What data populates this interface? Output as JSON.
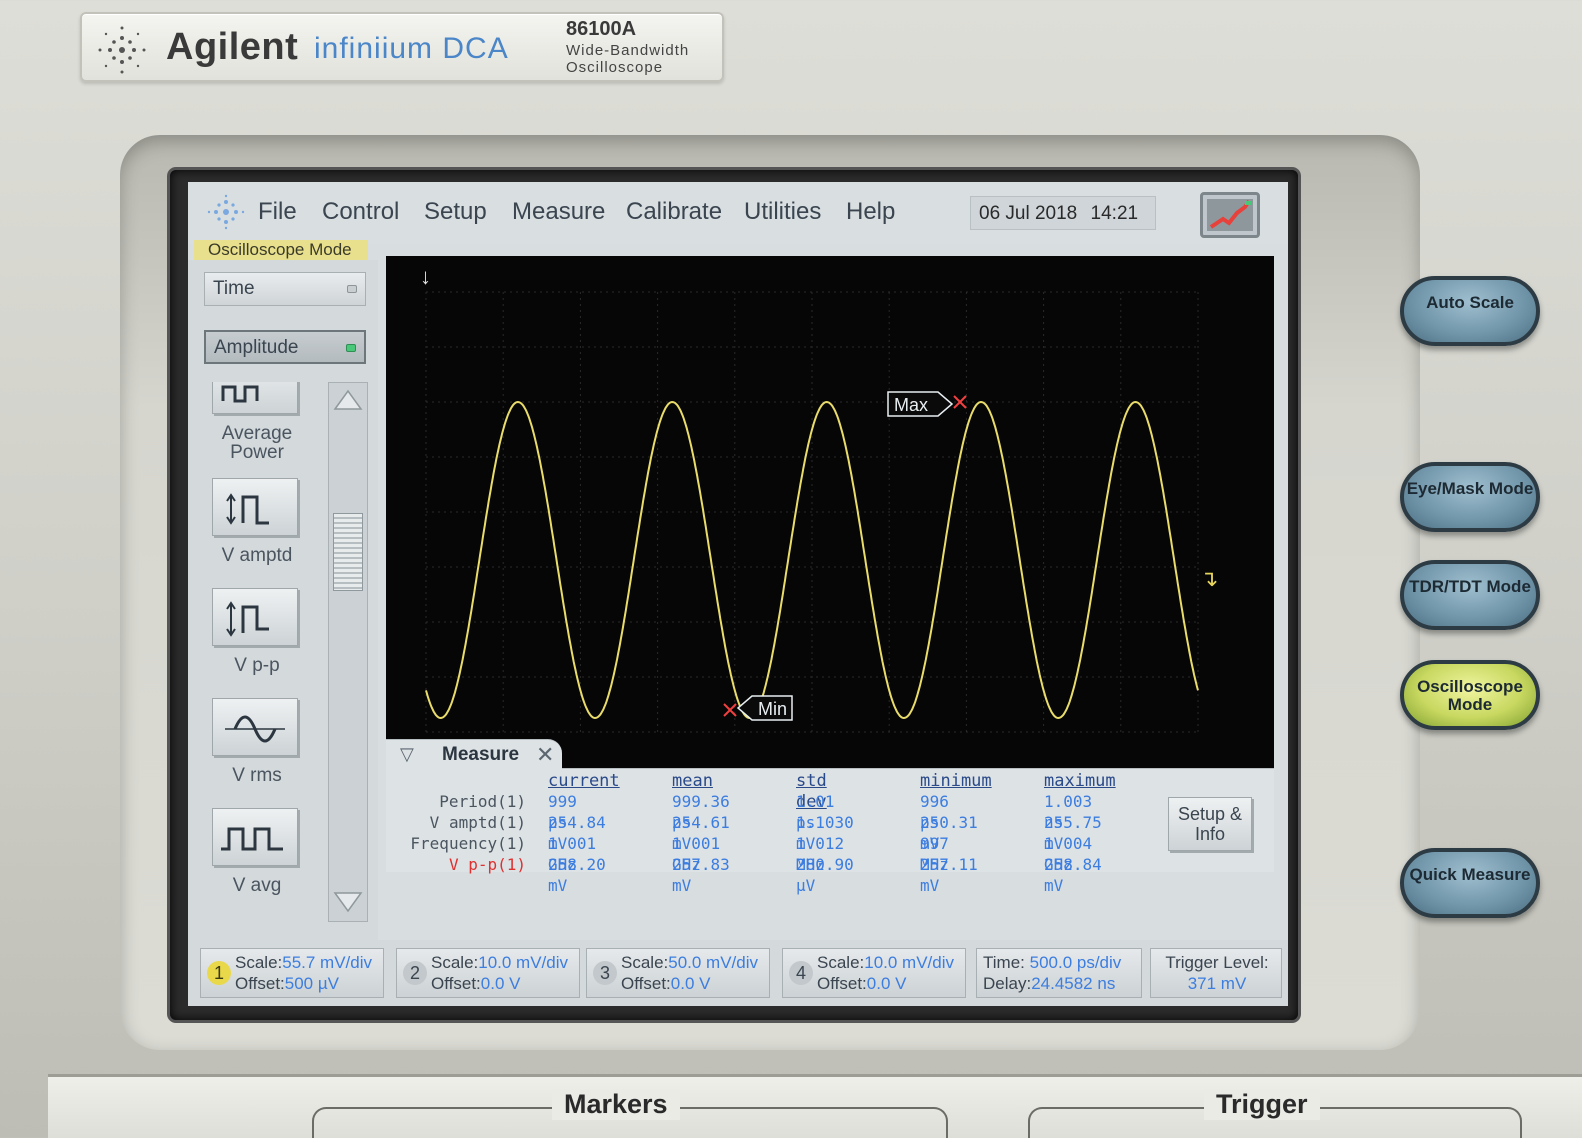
{
  "brand": {
    "name": "Agilent",
    "product": "infiniium DCA",
    "model": "86100A",
    "description_line1": "Wide-Bandwidth",
    "description_line2": "Oscilloscope"
  },
  "menu": {
    "items": [
      "File",
      "Control",
      "Setup",
      "Measure",
      "Calibrate",
      "Utilities",
      "Help"
    ],
    "date": "06 Jul 2018",
    "time": "14:21"
  },
  "mode_label": "Oscilloscope Mode",
  "left_panel": {
    "tabs": [
      {
        "label": "Time",
        "selected": false
      },
      {
        "label": "Amplitude",
        "selected": true
      }
    ],
    "measurements": [
      {
        "label": "Average Power",
        "icon": "average-power-icon"
      },
      {
        "label": "V amptd",
        "icon": "v-amptd-icon"
      },
      {
        "label": "V p-p",
        "icon": "v-pp-icon"
      },
      {
        "label": "V rms",
        "icon": "v-rms-icon"
      },
      {
        "label": "V avg",
        "icon": "v-avg-icon"
      }
    ]
  },
  "waveform": {
    "color": "#e9dc6a",
    "peaks": 5,
    "markers": {
      "max": "Max",
      "min": "Min"
    }
  },
  "measure_panel": {
    "title": "Measure",
    "columns": [
      "current",
      "mean",
      "std dev",
      "minimum",
      "maximum"
    ],
    "rows": [
      {
        "name": "Period(1)",
        "values": [
          "999 ps",
          "999.36 ps",
          "1.01 ps",
          "996 ps",
          "1.003 ns"
        ],
        "highlight": false
      },
      {
        "name": "V amptd(1)",
        "values": [
          "254.84 mV",
          "254.61 mV",
          "1.1030 mV",
          "250.31 mV",
          "255.75 mV"
        ],
        "highlight": false
      },
      {
        "name": "Frequency(1)",
        "values": [
          "1.001 GHz",
          "1.001 GHz",
          "1.012 MHz",
          "997 MHz",
          "1.004 GHz"
        ],
        "highlight": false
      },
      {
        "name": "V p-p(1)",
        "values": [
          "258.20 mV",
          "257.83 mV",
          "280.90 µV",
          "257.11 mV",
          "258.84 mV"
        ],
        "highlight": true
      }
    ],
    "setup_button": "Setup & Info"
  },
  "status_bar": {
    "channels": [
      {
        "num": "1",
        "scale_label": "Scale:",
        "scale": "55.7 mV/div",
        "offset_label": "Offset:",
        "offset": "500 µV",
        "active": true
      },
      {
        "num": "2",
        "scale_label": "Scale:",
        "scale": "10.0 mV/div",
        "offset_label": "Offset:",
        "offset": "0.0 V",
        "active": false
      },
      {
        "num": "3",
        "scale_label": "Scale:",
        "scale": "50.0 mV/div",
        "offset_label": "Offset:",
        "offset": "0.0 V",
        "active": false
      },
      {
        "num": "4",
        "scale_label": "Scale:",
        "scale": "10.0 mV/div",
        "offset_label": "Offset:",
        "offset": "0.0 V",
        "active": false
      }
    ],
    "timebase": {
      "time_label": "Time:",
      "time": "500.0 ps/div",
      "delay_label": "Delay:",
      "delay": "24.4582 ns"
    },
    "trigger": {
      "label": "Trigger Level:",
      "value": "371 mV"
    }
  },
  "hardware_buttons": [
    {
      "label": "Auto Scale",
      "lit": false
    },
    {
      "label": "Eye/Mask Mode",
      "lit": false
    },
    {
      "label": "TDR/TDT Mode",
      "lit": false
    },
    {
      "label": "Oscilloscope Mode",
      "lit": true
    },
    {
      "label": "Quick Measure",
      "lit": false
    }
  ],
  "lower_panel": {
    "markers_title": "Markers",
    "trigger_title": "Trigger"
  }
}
